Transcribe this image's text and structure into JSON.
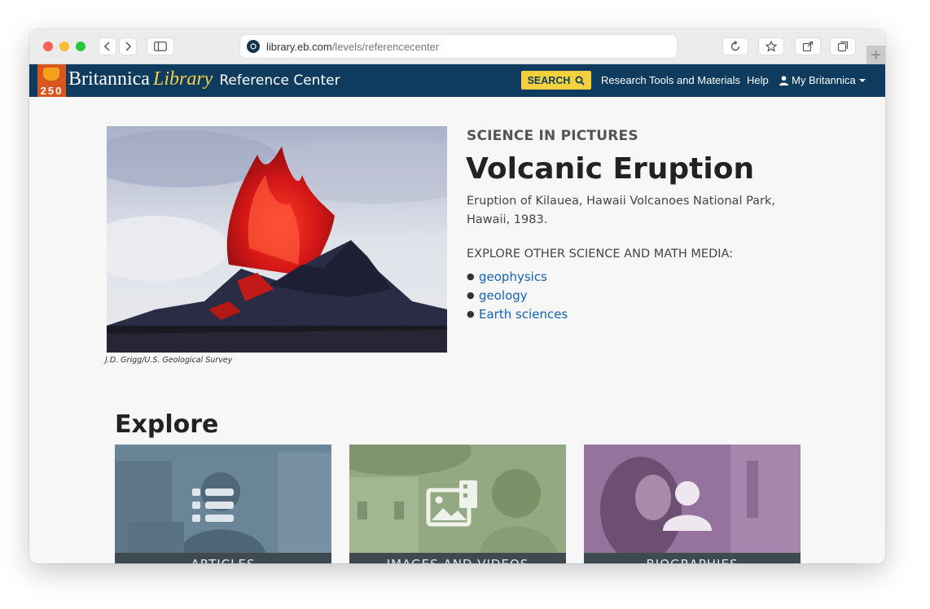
{
  "browser": {
    "url_host": "library.eb.com",
    "url_path": "/levels/referencecenter"
  },
  "header": {
    "logo_number": "250",
    "brand_britannica": "Britannica",
    "brand_library": "Library",
    "brand_center": "Reference Center",
    "search_label": "SEARCH",
    "research_label": "Research Tools and Materials",
    "help_label": "Help",
    "account_label": "My Britannica",
    "colors": {
      "header_bg": "#0e3b5e",
      "search_bg": "#f3d03e",
      "accent": "#d9561e"
    }
  },
  "feature": {
    "eyebrow": "SCIENCE IN PICTURES",
    "title": "Volcanic Eruption",
    "caption": "Eruption of Kilauea, Hawaii Volcanoes National Park, Hawaii, 1983.",
    "image_credit": "J.D. Grigg/U.S. Geological Survey",
    "explore_label": "EXPLORE OTHER SCIENCE AND MATH MEDIA:",
    "links": [
      "geophysics",
      "geology",
      "Earth sciences"
    ]
  },
  "explore": {
    "title": "Explore",
    "cards": [
      {
        "label": "ARTICLES",
        "icon": "list-icon"
      },
      {
        "label": "IMAGES AND VIDEOS",
        "icon": "media-icon"
      },
      {
        "label": "BIOGRAPHIES",
        "icon": "person-icon"
      }
    ]
  }
}
